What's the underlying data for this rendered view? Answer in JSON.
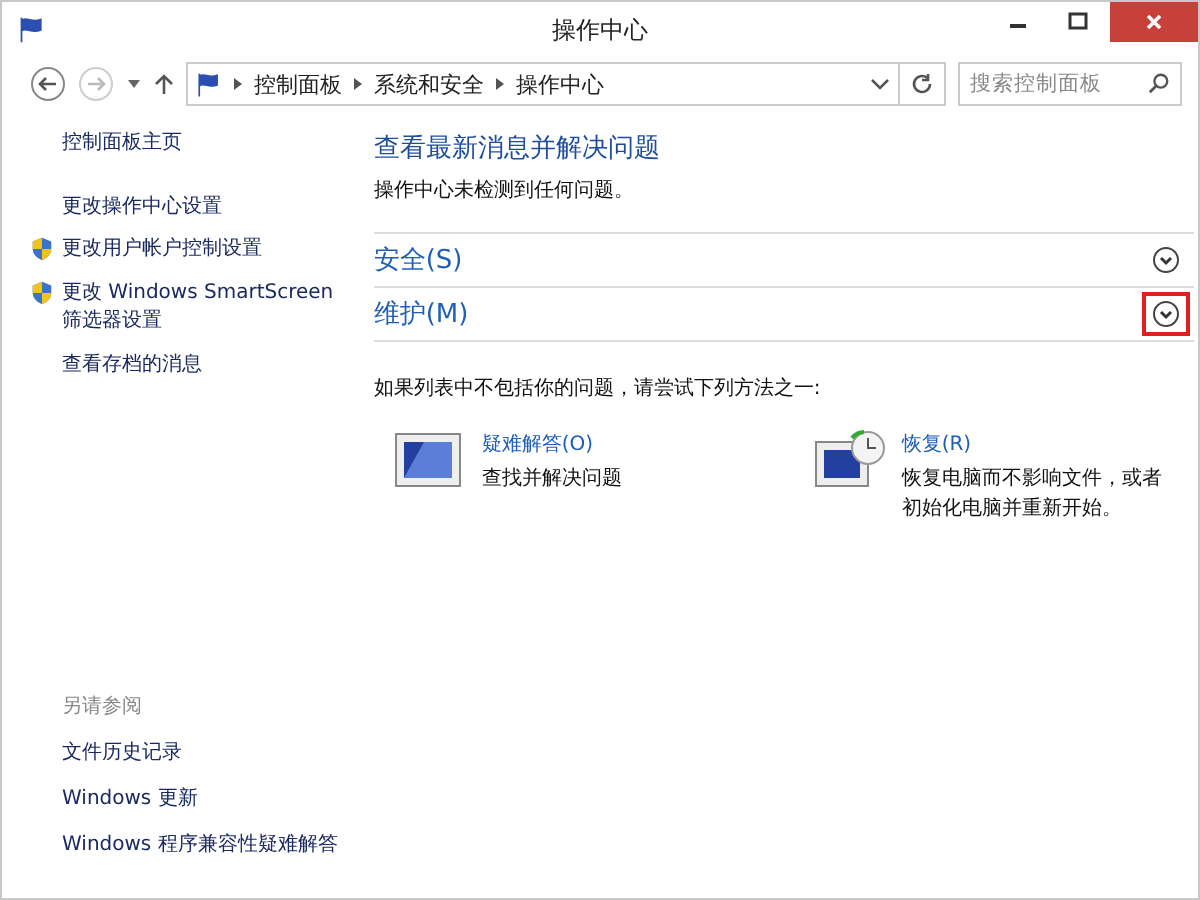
{
  "window": {
    "title": "操作中心"
  },
  "address_bar": {
    "crumbs": [
      "控制面板",
      "系统和安全",
      "操作中心"
    ],
    "search_placeholder": "搜索控制面板"
  },
  "sidebar": {
    "items": [
      {
        "label": "控制面板主页",
        "shield": false
      },
      {
        "label": "更改操作中心设置",
        "shield": false
      },
      {
        "label": "更改用户帐户控制设置",
        "shield": true
      },
      {
        "label": "更改 Windows SmartScreen 筛选器设置",
        "shield": true
      },
      {
        "label": "查看存档的消息",
        "shield": false
      }
    ],
    "see_also_title": "另请参阅",
    "see_also": [
      "文件历史记录",
      "Windows 更新",
      "Windows 程序兼容性疑难解答"
    ]
  },
  "main": {
    "heading": "查看最新消息并解决问题",
    "status": "操作中心未检测到任何问题。",
    "sections": [
      {
        "label": "安全(S)",
        "highlighted": false
      },
      {
        "label": "维护(M)",
        "highlighted": true
      }
    ],
    "hint": "如果列表中不包括你的问题，请尝试下列方法之一:",
    "actions": [
      {
        "kind": "troubleshoot",
        "title": "疑难解答(O)",
        "description": "查找并解决问题"
      },
      {
        "kind": "recovery",
        "title": "恢复(R)",
        "description": "恢复电脑而不影响文件，或者初始化电脑并重新开始。"
      }
    ]
  }
}
